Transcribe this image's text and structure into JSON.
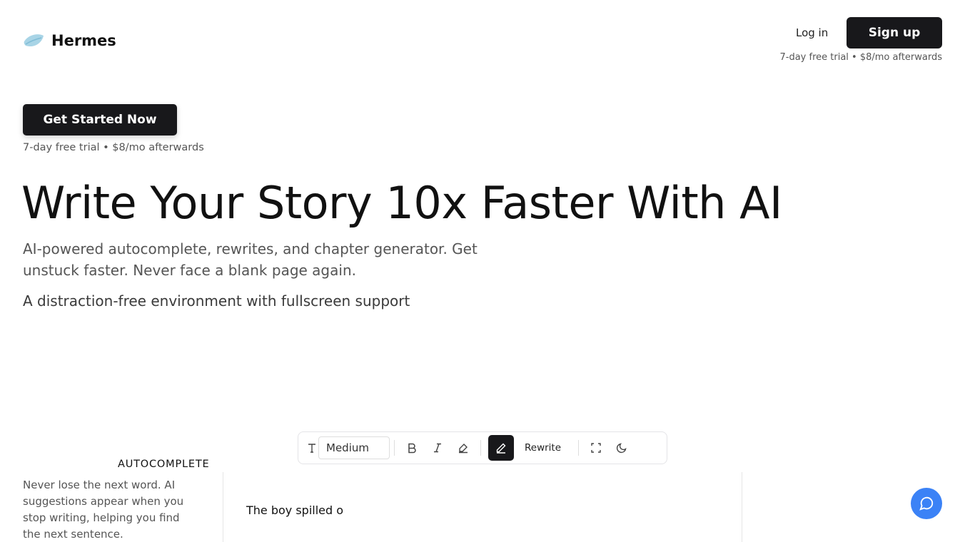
{
  "header": {
    "brand": "Hermes",
    "login_label": "Log in",
    "signup_label": "Sign up",
    "trial_note": "7-day free trial • $8/mo afterwards"
  },
  "hero": {
    "cta_label": "Get Started Now",
    "trial_note": "7-day free trial • $8/mo afterwards",
    "headline": "Write Your Story 10x Faster With AI",
    "subheadline": "AI-powered autocomplete, rewrites, and chapter generator. Get unstuck faster. Never face a blank page again.",
    "tagline": "A distraction-free environment with fullscreen support"
  },
  "toolbar": {
    "font_size_value": "Medium",
    "rewrite_label": "Rewrite",
    "icons": [
      "text-size-icon",
      "bold-icon",
      "italic-icon",
      "highlight-icon",
      "pen-icon",
      "fullscreen-icon",
      "dark-mode-icon"
    ]
  },
  "feature": {
    "title": "AUTOCOMPLETE",
    "description": "Never lose the next word. AI suggestions appear when you stop writing, helping you find the next sentence."
  },
  "editor": {
    "text": "The boy spilled o"
  },
  "colors": {
    "primary": "#18181b",
    "chat_accent": "#3b82f6",
    "logo_accent": "#a8d4e6"
  }
}
